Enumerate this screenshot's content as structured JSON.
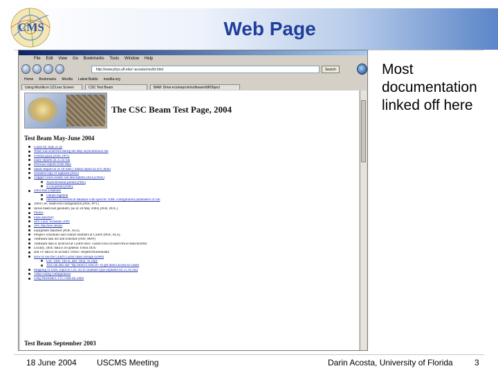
{
  "slide": {
    "title": "Web Page",
    "annotation": "Most documentation linked off here"
  },
  "footer": {
    "date": "18 June 2004",
    "meeting": "USCMS Meeting",
    "presenter": "Darin Acosta, University of Florida",
    "page_number": "3"
  },
  "browser": {
    "menu_items": [
      "File",
      "Edit",
      "View",
      "Go",
      "Bookmarks",
      "Tools",
      "Window",
      "Help"
    ],
    "url": "http://www.phys.ufl.edu/~acosta/cms/bt.html",
    "search_label": "Search",
    "bookmarks": [
      "Home",
      "Bookmarks",
      "Mozilla",
      "Latest Builds",
      "mozilla.org"
    ],
    "tabs": [
      "Using Mozilla in 123.xxx Screen",
      "CSC Test Beam",
      "BAM: Drive:ecs/eeprom/software/tdf/Object"
    ],
    "page": {
      "heading": "The CSC Beam Test Page, 2004",
      "section_1": "Test Beam May-June 2004",
      "section_2": "Test Beam September 2003",
      "links": [
        {
          "text": "Goals for June 25 ns",
          "kind": "link"
        },
        {
          "text": "What was achieved during the May asynchronous run",
          "kind": "link"
        },
        {
          "text": "Overall goals [PDF, PPT]",
          "kind": "link"
        },
        {
          "text": "Daily reports on 25 ns run",
          "kind": "link"
        },
        {
          "text": "Previous reports from May",
          "kind": "link"
        },
        {
          "text": "Status Report as of 18 June ( Status report as of 6 June)",
          "kind": "link"
        },
        {
          "text": "Scanned copy of logbook (New)",
          "kind": "link"
        },
        {
          "text": "Trigger/Track-Finder run description [XLS] (New)",
          "kind": "link"
        },
        {
          "text": "Asynchronous period [PDF]",
          "kind": "sub"
        },
        {
          "text": "25 ns period [PDF]",
          "kind": "sub"
        },
        {
          "text": "2004 Run Database",
          "kind": "link"
        },
        {
          "text": "Online logbook",
          "kind": "sub"
        },
        {
          "text": "Interface to technical database with specific XML configuration parameters of run",
          "kind": "sub"
        },
        {
          "text": "2004 CSC beam test configuration [PDF, PPT]",
          "kind": "plain"
        },
        {
          "text": "Initial beam test geometry (as of 28 May 2004) [PDF, DOC]",
          "kind": "plain"
        },
        {
          "text": "Photos",
          "kind": "link"
        },
        {
          "text": "Files directory",
          "kind": "link"
        },
        {
          "text": "SPS Linac Schedule 2004",
          "kind": "link"
        },
        {
          "text": "SPS Machine details",
          "kind": "link"
        },
        {
          "text": "Equipment manifest [PDF, XLS]",
          "kind": "plain"
        },
        {
          "text": "People's schedules and contact numbers at CERN [PDF, XLS]",
          "kind": "plain"
        },
        {
          "text": "Testbeam task list and schedule [PDF, MPP]",
          "kind": "plain"
        },
        {
          "text": "Testbeam data is archived at CERN here: /castor/cern.ch/user/t/tbcsc/tests/tb2004/",
          "kind": "plain"
        },
        {
          "text": "Locally, DDU data is on general Triton DDU",
          "kind": "plain"
        },
        {
          "text": "and TF data is on acosta's Triton: /hsqtest/tfcanonidata",
          "kind": "plain"
        },
        {
          "text": "How to use the CERN Castor mass storage system",
          "kind": "link"
        },
        {
          "text": "Use \"nfds\" file ls, and \"nfcp\" to copy",
          "kind": "sub"
        },
        {
          "text": "You can also use \"ftp.cernccc.cern.ch\" to get direct access to castor",
          "kind": "sub"
        },
        {
          "text": "Mapping of DDU input to CSC ID to chamber type (updated for 25 ns run)",
          "kind": "link"
        },
        {
          "text": "TMB config configuration",
          "kind": "link"
        },
        {
          "text": "Greg Pawloski's TTC code for 2004",
          "kind": "link"
        }
      ]
    }
  },
  "colors": {
    "title": "#1f3e9c",
    "link": "#1c2fae",
    "header_gradient_end": "#5b86c8"
  },
  "icons": [
    "cms-logo",
    "back-arrow-icon",
    "forward-arrow-icon",
    "reload-icon",
    "stop-icon",
    "globe-icon"
  ]
}
